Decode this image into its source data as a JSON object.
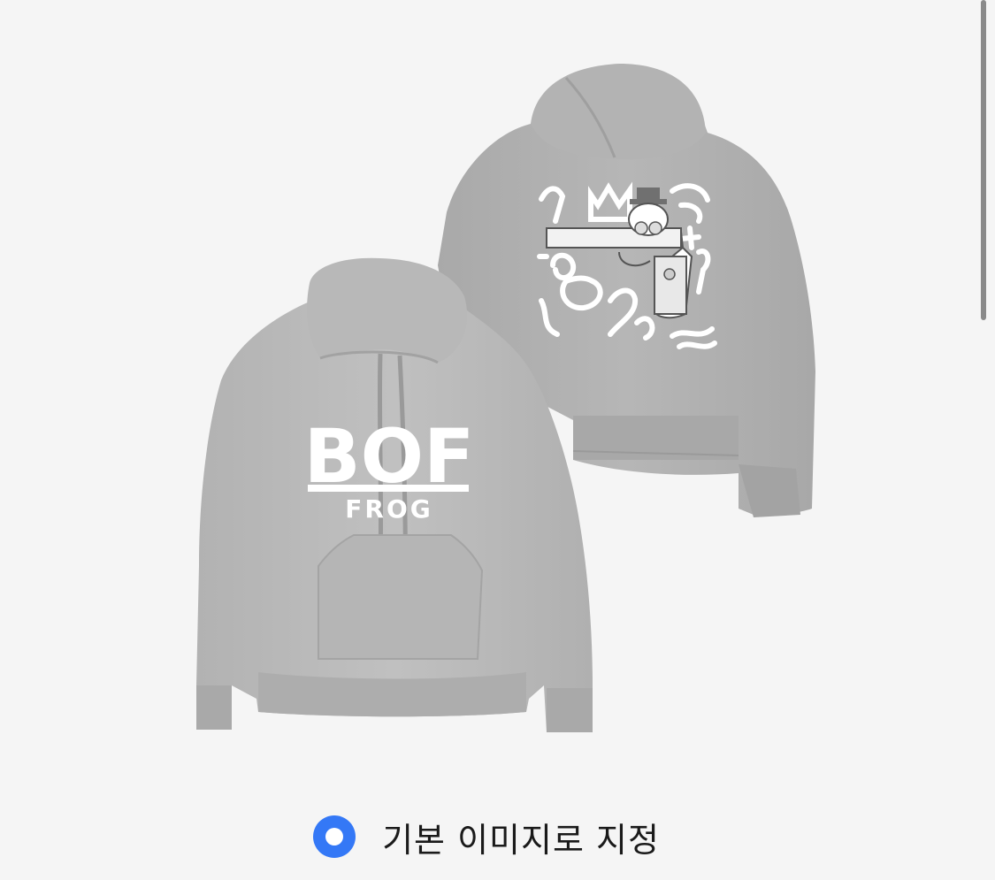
{
  "product": {
    "front_print_text": "BOF",
    "front_print_subtext": "FROG"
  },
  "default_image_option": {
    "label": "기본 이미지로 지정",
    "selected": true,
    "accent_color": "#3478f6"
  },
  "colors": {
    "background": "#f5f5f5",
    "hoodie_gray": "#b9b9b9",
    "print_white": "#ffffff"
  }
}
